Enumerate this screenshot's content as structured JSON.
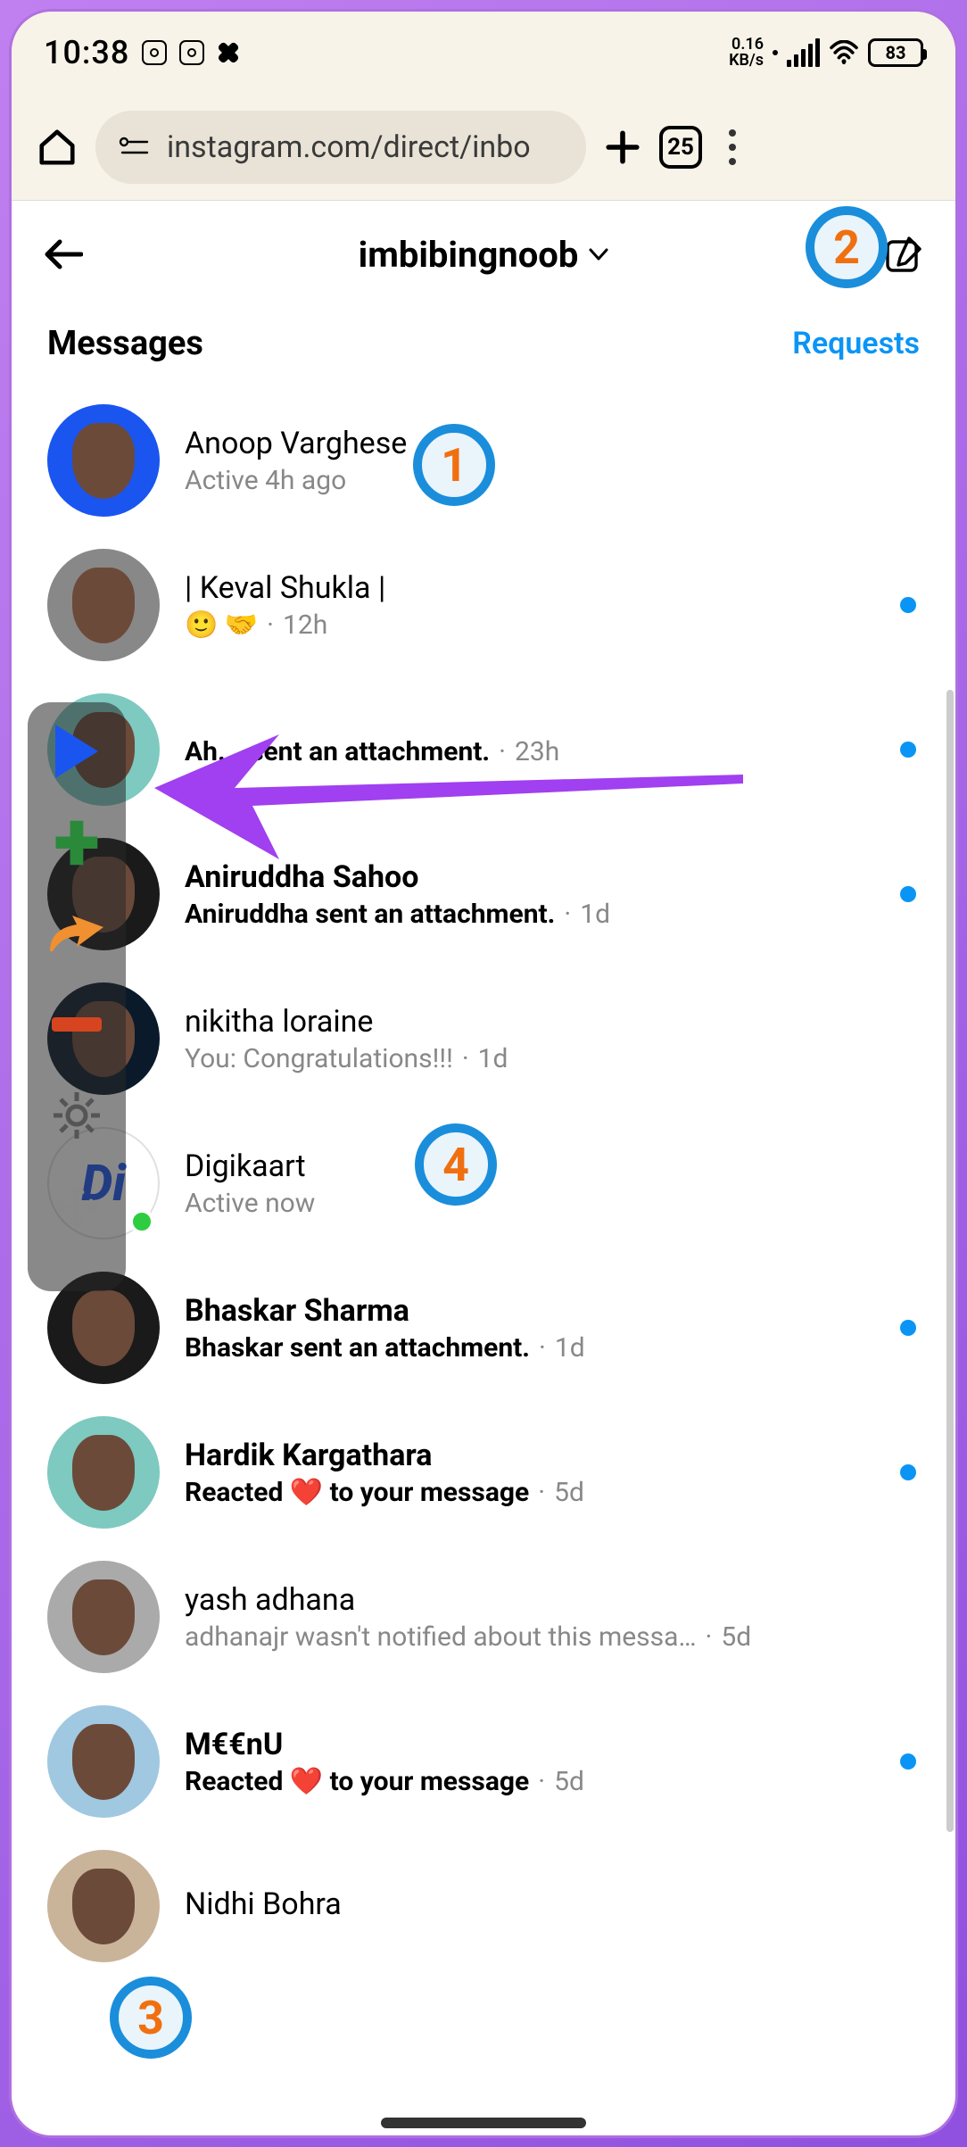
{
  "status": {
    "time": "10:38",
    "data_rate_top": "0.16",
    "data_rate_bottom": "KB/s",
    "battery_pct": "83"
  },
  "browser": {
    "url": "instagram.com/direct/inbo",
    "tab_count": "25"
  },
  "header": {
    "username": "imbibingnoob"
  },
  "section": {
    "messages_label": "Messages",
    "requests_label": "Requests"
  },
  "chats": [
    {
      "name": "Anoop Varghese",
      "sub": "Active 4h ago",
      "bold": false,
      "unread": false,
      "avatar": "blue-bg",
      "time": ""
    },
    {
      "name": "| Keval Shukla |",
      "sub": "🙂 🤝",
      "bold": false,
      "unread": true,
      "avatar": "grey-bg",
      "time": "12h"
    },
    {
      "name": "",
      "sub": "sent an attachment.",
      "bold": true,
      "unread": true,
      "avatar": "teal-bg",
      "time": "23h",
      "partial": "Ah..."
    },
    {
      "name": "Aniruddha Sahoo",
      "sub": "Aniruddha sent an attachment.",
      "bold": true,
      "unread": true,
      "avatar": "dark-bg",
      "time": "1d"
    },
    {
      "name": "nikitha loraine",
      "sub": "You: Congratulations!!!",
      "bold": false,
      "unread": false,
      "avatar": "night-bg",
      "time": "1d"
    },
    {
      "name": "Digikaart",
      "sub": "Active now",
      "bold": false,
      "unread": false,
      "avatar": "white-bg",
      "time": "",
      "logo": "Di",
      "online": true
    },
    {
      "name": "Bhaskar Sharma",
      "sub": "Bhaskar sent an attachment.",
      "bold": true,
      "unread": true,
      "avatar": "dark-bg",
      "time": "1d"
    },
    {
      "name": "Hardik Kargathara",
      "sub": "Reacted ❤️ to your message",
      "bold": true,
      "unread": true,
      "avatar": "teal-bg",
      "time": "5d"
    },
    {
      "name": "yash adhana",
      "sub": "adhanajr wasn't notified about this messa…",
      "bold": false,
      "unread": false,
      "avatar": "gray2-bg",
      "time": "5d"
    },
    {
      "name": "M€€nU",
      "sub": "Reacted ❤️ to your message",
      "bold": true,
      "unread": true,
      "avatar": "sky-bg",
      "time": "5d"
    },
    {
      "name": "Nidhi Bohra",
      "sub": "",
      "bold": false,
      "unread": false,
      "avatar": "tan-bg",
      "time": ""
    }
  ],
  "annotations": {
    "c1": "1",
    "c2": "2",
    "c3": "3",
    "c4": "4"
  }
}
